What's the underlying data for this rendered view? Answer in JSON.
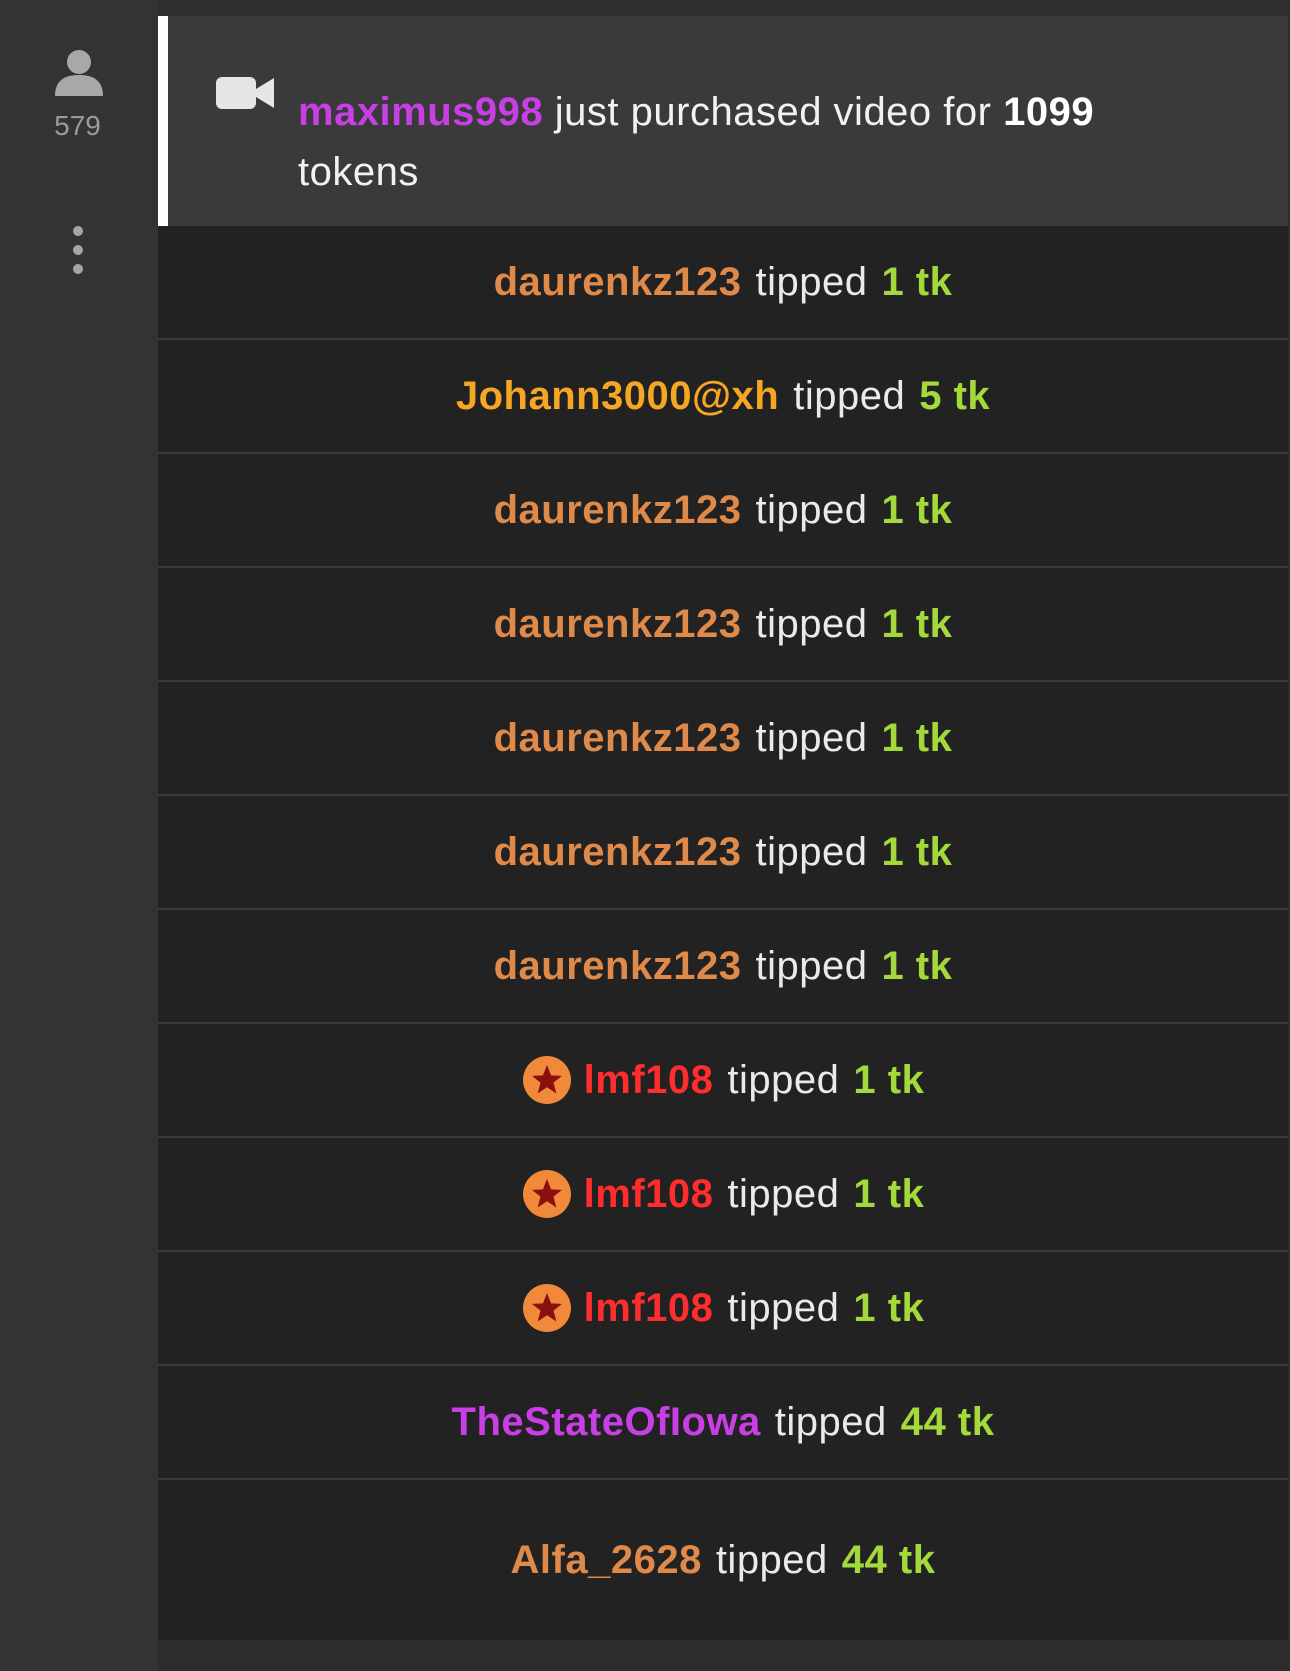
{
  "sidebar": {
    "viewer_icon": "user-icon",
    "viewer_count": "579",
    "menu_icon": "kebab-menu-icon"
  },
  "purchase": {
    "icon": "video-camera-icon",
    "username": "maximus998",
    "text": "just purchased video for",
    "amount": "1099",
    "unit": "tokens",
    "username_color": "#c93fe6"
  },
  "tips": [
    {
      "username": "daurenkz123",
      "verb": "tipped",
      "amount": "1 tk",
      "color": "#e08a4a",
      "badge": false
    },
    {
      "username": "Johann3000@xh",
      "verb": "tipped",
      "amount": "5 tk",
      "color": "#f5a623",
      "badge": false
    },
    {
      "username": "daurenkz123",
      "verb": "tipped",
      "amount": "1 tk",
      "color": "#e08a4a",
      "badge": false
    },
    {
      "username": "daurenkz123",
      "verb": "tipped",
      "amount": "1 tk",
      "color": "#e08a4a",
      "badge": false
    },
    {
      "username": "daurenkz123",
      "verb": "tipped",
      "amount": "1 tk",
      "color": "#e08a4a",
      "badge": false
    },
    {
      "username": "daurenkz123",
      "verb": "tipped",
      "amount": "1 tk",
      "color": "#e08a4a",
      "badge": false
    },
    {
      "username": "daurenkz123",
      "verb": "tipped",
      "amount": "1 tk",
      "color": "#e08a4a",
      "badge": false
    },
    {
      "username": "lmf108",
      "verb": "tipped",
      "amount": "1 tk",
      "color": "#ff2d2d",
      "badge": true
    },
    {
      "username": "lmf108",
      "verb": "tipped",
      "amount": "1 tk",
      "color": "#ff2d2d",
      "badge": true
    },
    {
      "username": "lmf108",
      "verb": "tipped",
      "amount": "1 tk",
      "color": "#ff2d2d",
      "badge": true
    },
    {
      "username": "TheStateOfIowa",
      "verb": "tipped",
      "amount": "44 tk",
      "color": "#c93fe6",
      "badge": false
    },
    {
      "username": "Alfa_2628",
      "verb": "tipped",
      "amount": "44 tk",
      "color": "#e08a4a",
      "badge": false
    }
  ],
  "colors": {
    "amount": "#a4d93b",
    "badge_fill": "#f08a3a",
    "badge_star": "#8b0f0f"
  },
  "badge_icon": "star-badge-icon"
}
